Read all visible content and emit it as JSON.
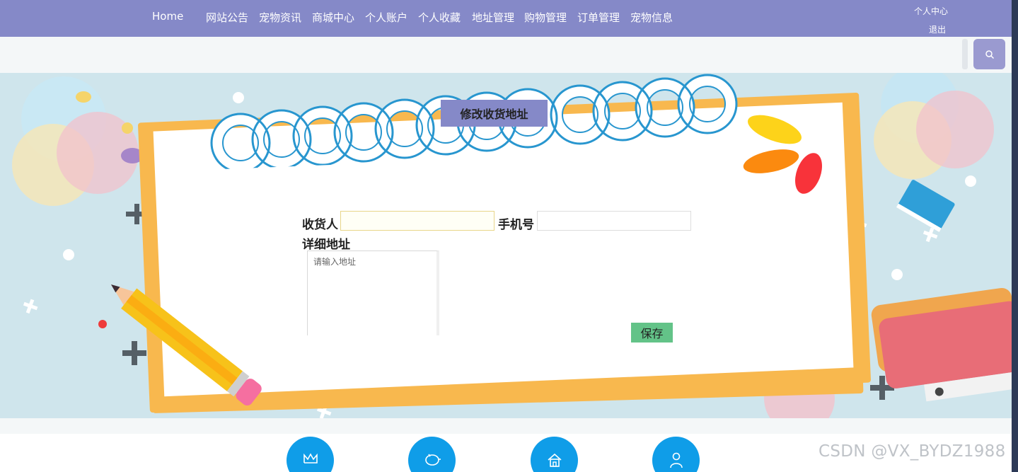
{
  "nav": {
    "items": [
      "Home",
      "网站公告",
      "宠物资讯",
      "商城中心",
      "个人账户",
      "个人收藏",
      "地址管理",
      "购物管理",
      "订单管理",
      "宠物信息"
    ],
    "personal_center": "个人中心",
    "logout": "退出"
  },
  "page": {
    "title": "修改收货地址"
  },
  "form": {
    "receiver_label": "收货人",
    "receiver_value": "",
    "phone_label": "手机号",
    "phone_value": "",
    "address_label": "详细地址",
    "address_placeholder": "请输入地址",
    "save_label": "保存"
  },
  "footer": {
    "icons": [
      "crown-icon",
      "piggy-bank-icon",
      "home-icon",
      "user-icon"
    ]
  },
  "watermark": "CSDN @VX_BYDZ1988",
  "colors": {
    "nav_bg": "#8589c8",
    "accent_orange": "#f8b84e",
    "save_green": "#63c388",
    "icon_blue": "#0f9de8",
    "banner_bg": "#cfe5ec"
  }
}
